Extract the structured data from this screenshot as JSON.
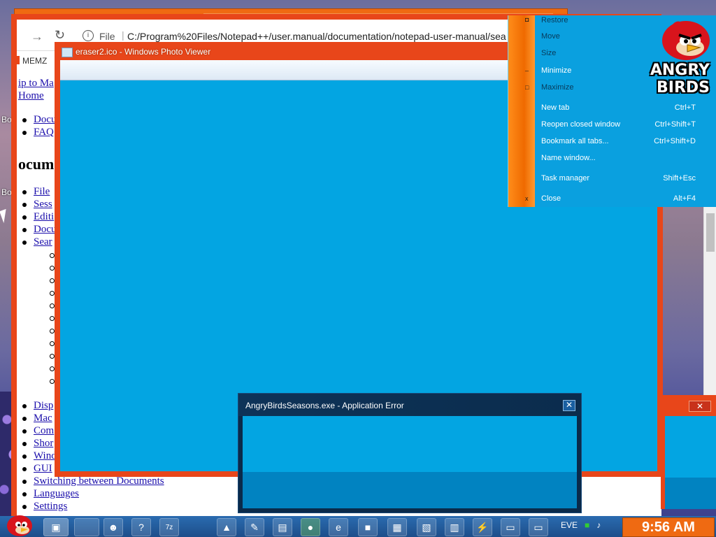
{
  "desktop": {
    "label1": "Bo",
    "label2": "Bo"
  },
  "browser": {
    "forward_icon": "→",
    "reload_icon": "↻",
    "info_icon": "i",
    "url_scheme": "File",
    "url_sep": "|",
    "url": "C:/Program%20Files/Notepad++/user.manual/documentation/notepad-user-manual/sea",
    "tab_label": "MEMZ"
  },
  "page": {
    "skip_link": "ip to Ma",
    "home_link": "Home",
    "top_links": [
      "Docu",
      "FAQ"
    ],
    "heading": "ocum",
    "section_links": [
      "File",
      "Sess",
      "Editi",
      "Docu",
      "Sear"
    ],
    "bottom_links": [
      "Disp",
      "Mac",
      "Com",
      "Shor",
      "Wind",
      "GUI",
      "Switching between Documents",
      "Languages",
      "Settings"
    ]
  },
  "photo_viewer": {
    "title": "eraser2.ico - Windows Photo Viewer"
  },
  "error_dialog": {
    "title": "AngryBirdsSeasons.exe - Application Error",
    "close": "✕"
  },
  "right_window": {
    "close": "✕"
  },
  "context_menu": {
    "items": [
      {
        "label": "Restore",
        "shortcut": "",
        "disabled": true,
        "glyph": "◘"
      },
      {
        "label": "Move",
        "shortcut": "",
        "disabled": true,
        "glyph": ""
      },
      {
        "label": "Size",
        "shortcut": "",
        "disabled": true,
        "glyph": ""
      },
      {
        "label": "Minimize",
        "shortcut": "",
        "disabled": false,
        "glyph": "_"
      },
      {
        "label": "Maximize",
        "shortcut": "",
        "disabled": true,
        "glyph": "□"
      },
      {
        "label": "New tab",
        "shortcut": "Ctrl+T",
        "disabled": false,
        "glyph": ""
      },
      {
        "label": "Reopen closed window",
        "shortcut": "Ctrl+Shift+T",
        "disabled": false,
        "glyph": ""
      },
      {
        "label": "Bookmark all tabs...",
        "shortcut": "Ctrl+Shift+D",
        "disabled": false,
        "glyph": ""
      },
      {
        "label": "Name window...",
        "shortcut": "",
        "disabled": false,
        "glyph": ""
      },
      {
        "label": "Task manager",
        "shortcut": "Shift+Esc",
        "disabled": false,
        "glyph": ""
      },
      {
        "label": "Close",
        "shortcut": "Alt+F4",
        "disabled": false,
        "glyph": "x"
      }
    ],
    "logo_line1": "ANGRY",
    "logo_line2": "BIRDS"
  },
  "taskbar": {
    "buttons": [
      "folder-icon",
      "chat-icon",
      "help-icon",
      "7zip-icon",
      "vlc-icon",
      "paint-icon",
      "notepad-icon",
      "media-icon",
      "ie-icon",
      "app-icon",
      "app2-icon",
      "app3-icon",
      "app4-icon",
      "flash-icon",
      "window-icon",
      "window2-icon"
    ],
    "tray_text": "EVE",
    "clock": "9:56 AM"
  },
  "colors": {
    "orange": "#e8461a",
    "cyan": "#03a5e2",
    "taskbar_blue": "#1d4e8a"
  }
}
